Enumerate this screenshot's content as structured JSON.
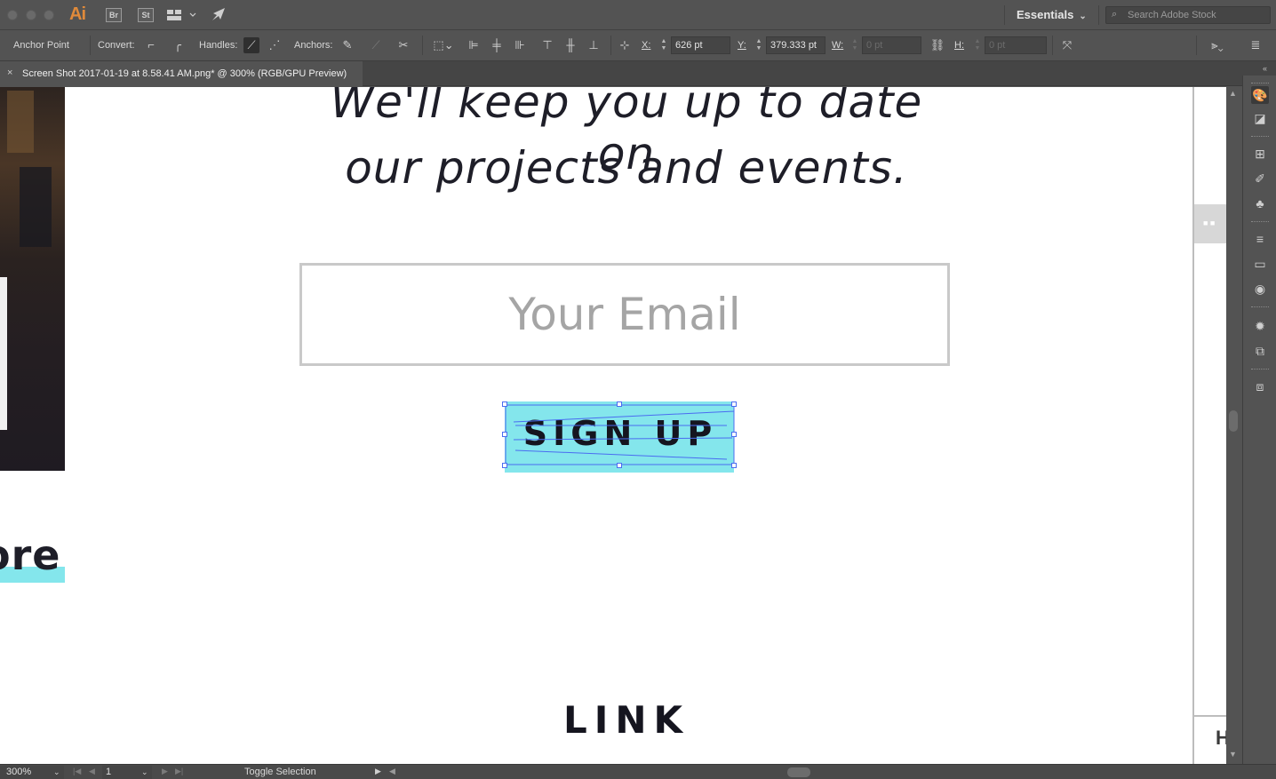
{
  "app": {
    "logo": "Ai",
    "bridge_label": "Br",
    "stock_label": "St",
    "workspace": "Essentials",
    "stock_search_placeholder": "Search Adobe Stock"
  },
  "control_bar": {
    "tool_name": "Anchor Point",
    "convert_label": "Convert:",
    "handles_label": "Handles:",
    "anchors_label": "Anchors:",
    "x_label": "X:",
    "x_value": "626 pt",
    "y_label": "Y:",
    "y_value": "379.333 pt",
    "w_label": "W:",
    "w_value": "0 pt",
    "h_label": "H:",
    "h_value": "0 pt"
  },
  "document": {
    "tab_title": "Screen Shot 2017-01-19 at 8.58.41 AM.png* @ 300% (RGB/GPU Preview)",
    "close_glyph": "×"
  },
  "artwork": {
    "headline_line1": "We'll keep you up to date on",
    "headline_line2": "our projects and events.",
    "email_placeholder": "Your Email",
    "signup_label": "SIGN UP",
    "partial_word": "ore",
    "link_label": "LINK",
    "right_edge_letter": "H",
    "highlight_color": "#84e6ec",
    "selection_color": "#4a6cf0"
  },
  "status_bar": {
    "zoom": "300%",
    "artboard": "1",
    "status_text": "Toggle Selection"
  }
}
